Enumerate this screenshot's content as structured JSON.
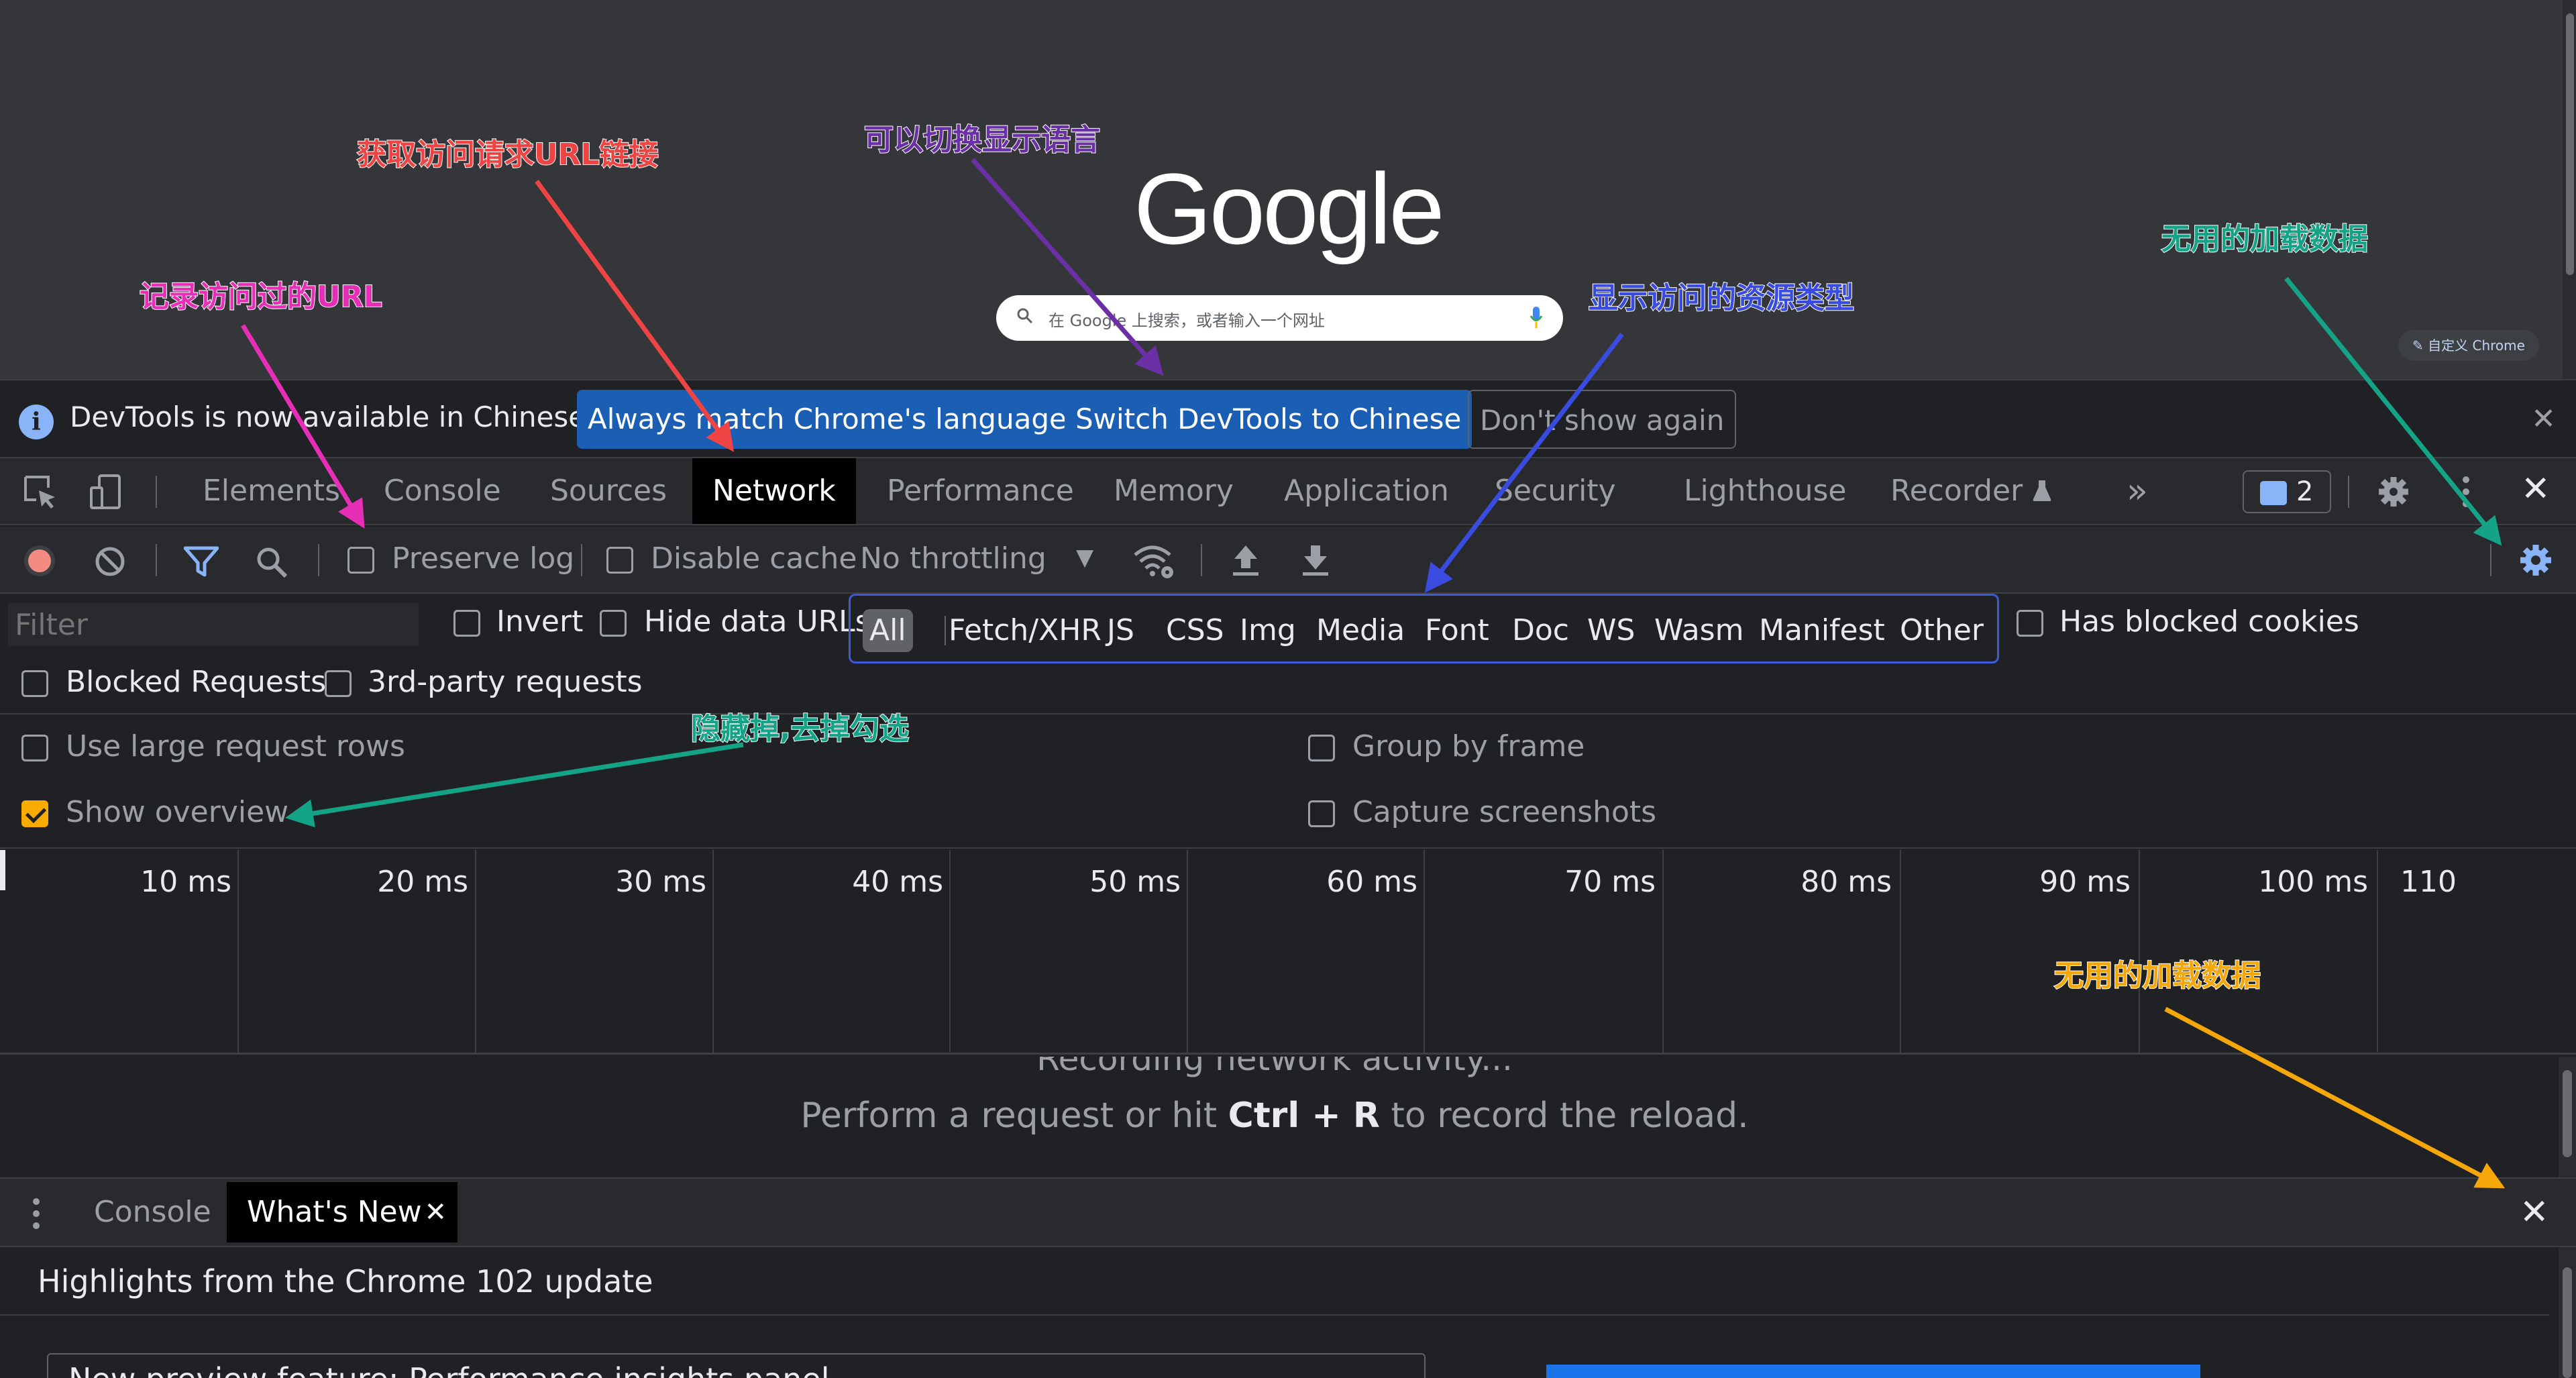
{
  "page": {
    "logo": "Google",
    "search_placeholder": "在 Google 上搜索，或者输入一个网址",
    "customize_label": "✎ 自定义 Chrome"
  },
  "infobar": {
    "message": "DevTools is now available in Chinese!",
    "btn_match": "Always match Chrome's language",
    "btn_switch": "Switch DevTools to Chinese",
    "btn_dont_show": "Don't show again",
    "close": "✕"
  },
  "tabs": {
    "elements": "Elements",
    "console": "Console",
    "sources": "Sources",
    "network": "Network",
    "performance": "Performance",
    "memory": "Memory",
    "application": "Application",
    "security": "Security",
    "lighthouse": "Lighthouse",
    "recorder": "Recorder",
    "more": "»",
    "issues_count": "2",
    "close": "✕"
  },
  "network_toolbar": {
    "preserve_log": "Preserve log",
    "disable_cache": "Disable cache",
    "throttling": "No throttling",
    "throttling_arrow": "▼"
  },
  "filter": {
    "placeholder": "Filter",
    "invert": "Invert",
    "hide_data_urls": "Hide data URLs",
    "types": [
      "All",
      "Fetch/XHR",
      "JS",
      "CSS",
      "Img",
      "Media",
      "Font",
      "Doc",
      "WS",
      "Wasm",
      "Manifest",
      "Other"
    ],
    "has_blocked_cookies": "Has blocked cookies",
    "blocked_requests": "Blocked Requests",
    "third_party": "3rd-party requests"
  },
  "settings": {
    "large_rows": "Use large request rows",
    "show_overview": "Show overview",
    "group_by_frame": "Group by frame",
    "capture_screenshots": "Capture screenshots"
  },
  "timeline": {
    "ticks": [
      "10 ms",
      "20 ms",
      "30 ms",
      "40 ms",
      "50 ms",
      "60 ms",
      "70 ms",
      "80 ms",
      "90 ms",
      "100 ms",
      "110"
    ]
  },
  "requests": {
    "status": "Recording network activity...",
    "hint_before": "Perform a request or hit ",
    "hint_keys": "Ctrl + R",
    "hint_after": " to record the reload."
  },
  "drawer": {
    "console": "Console",
    "whats_new": "What's New",
    "close_tab": "✕",
    "close": "✕",
    "highlights": "Highlights from the Chrome 102 update",
    "card_text": "New preview feature: Performance insights panel"
  },
  "annotations": {
    "record_urls": "记录访问过的URL",
    "get_request_url": "获取访问请求URL链接",
    "switch_language": "可以切换显示语言",
    "resource_types": "显示访问的资源类型",
    "useless_top": "无用的加载数据",
    "hide_uncheck": "隐藏掉,去掉勾选",
    "useless_bottom": "无用的加载数据"
  },
  "colors": {
    "record_red": "#f28b82",
    "accent_blue": "#8ab4f8",
    "checkbox_orange": "#f9ab00",
    "ann_pink": "#e62fb6",
    "ann_red": "#ef4444",
    "ann_purple": "#6b2fa6",
    "ann_blue": "#3a4ce0",
    "ann_green": "#14a386",
    "ann_orange": "#f5a70a"
  }
}
